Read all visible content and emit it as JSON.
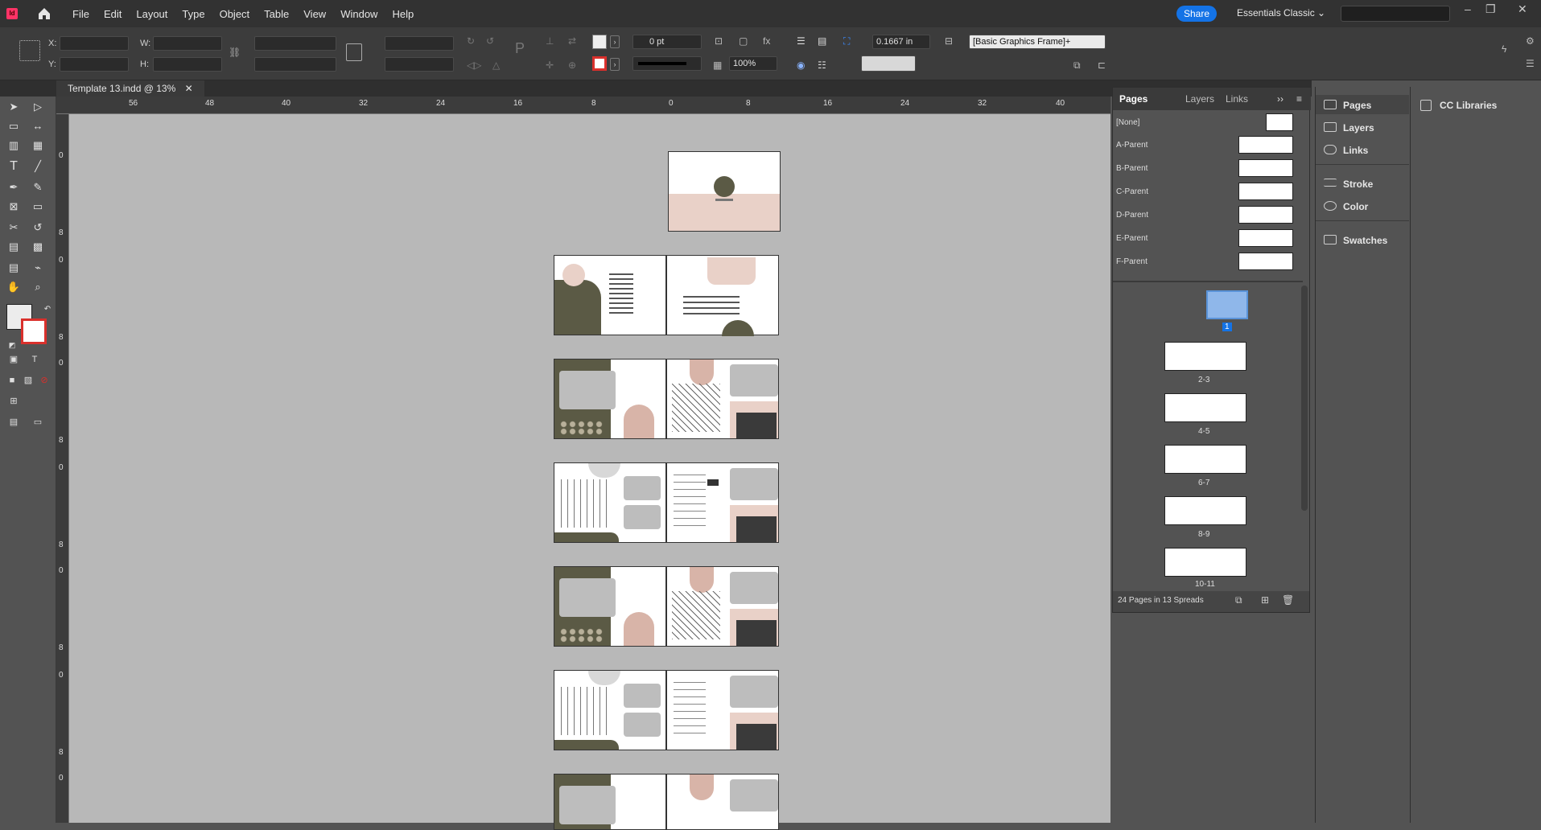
{
  "app": {
    "logo": "Id",
    "document_tab": "Template 13.indd @ 13%"
  },
  "menu": [
    "File",
    "Edit",
    "Layout",
    "Type",
    "Object",
    "Table",
    "View",
    "Window",
    "Help"
  ],
  "topbar": {
    "share": "Share",
    "workspace": "Essentials Classic"
  },
  "control": {
    "x_label": "X:",
    "y_label": "Y:",
    "w_label": "W:",
    "h_label": "H:",
    "stroke_weight": "0 pt",
    "opacity": "100%",
    "offset": "0.1667 in",
    "object_style": "[Basic Graphics Frame]+"
  },
  "ruler_h": [
    "56",
    "48",
    "40",
    "32",
    "24",
    "16",
    "8",
    "0",
    "8",
    "16",
    "24",
    "32",
    "40"
  ],
  "ruler_v": [
    "0",
    "8",
    "0",
    "8",
    "0",
    "8",
    "0",
    "8",
    "0",
    "8",
    "0",
    "8",
    "0",
    "8",
    "0"
  ],
  "pages_panel": {
    "tabs": [
      "Pages",
      "Layers",
      "Links"
    ],
    "parents": [
      "[None]",
      "A-Parent",
      "B-Parent",
      "C-Parent",
      "D-Parent",
      "E-Parent",
      "F-Parent"
    ],
    "spreads": [
      "1",
      "2-3",
      "4-5",
      "6-7",
      "8-9",
      "10-11"
    ],
    "footer": "24 Pages in 13 Spreads"
  },
  "dock": [
    "Pages",
    "Layers",
    "Links",
    "Stroke",
    "Color",
    "Swatches"
  ],
  "cc_libraries": "CC Libraries",
  "colors": {
    "olive": "#5b5a45",
    "blush": "#e9d1c8",
    "gray_box": "#bdbdbd",
    "accent_blue": "#1473e6"
  }
}
